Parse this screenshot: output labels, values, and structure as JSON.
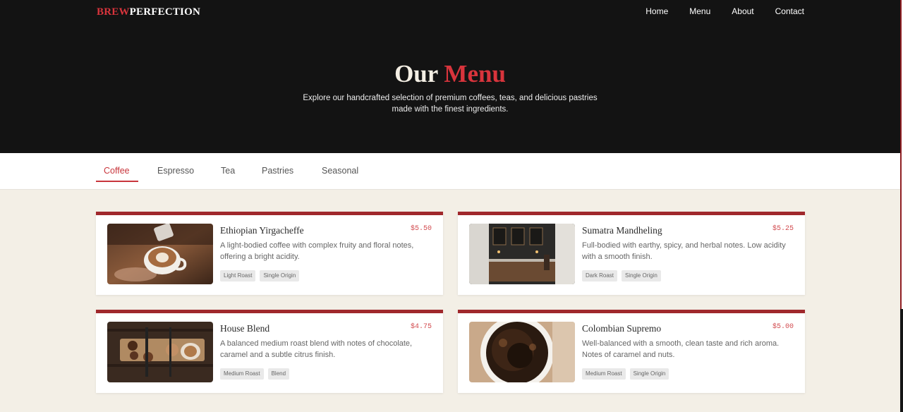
{
  "brand": {
    "part1": "BREW",
    "part2": "PERFECTION"
  },
  "nav": [
    "Home",
    "Menu",
    "About",
    "Contact"
  ],
  "hero": {
    "title_part1": "Our",
    "title_part2": "Menu",
    "subtitle": "Explore our handcrafted selection of premium coffees, teas, and delicious pastries made with the finest ingredients."
  },
  "tabs": [
    "Coffee",
    "Espresso",
    "Tea",
    "Pastries",
    "Seasonal"
  ],
  "active_tab": "Coffee",
  "items": [
    {
      "name": "Ethiopian Yirgacheffe",
      "price": "$5.50",
      "desc": "A light-bodied coffee with complex fruity and floral notes, offering a bright acidity.",
      "tags": [
        "Light Roast",
        "Single Origin"
      ],
      "image": "latte-art-cup"
    },
    {
      "name": "Sumatra Mandheling",
      "price": "$5.25",
      "desc": "Full-bodied with earthy, spicy, and herbal notes. Low acidity with a smooth finish.",
      "tags": [
        "Dark Roast",
        "Single Origin"
      ],
      "image": "cafe-interior"
    },
    {
      "name": "House Blend",
      "price": "$4.75",
      "desc": "A balanced medium roast blend with notes of chocolate, caramel and a subtle citrus finish.",
      "tags": [
        "Medium Roast",
        "Blend"
      ],
      "image": "coffee-board"
    },
    {
      "name": "Colombian Supremo",
      "price": "$5.00",
      "desc": "Well-balanced with a smooth, clean taste and rich aroma. Notes of caramel and nuts.",
      "tags": [
        "Medium Roast",
        "Single Origin"
      ],
      "image": "black-coffee-cup"
    }
  ],
  "colors": {
    "accent": "#d8343c",
    "card_border": "#a0282c",
    "hero_bg": "#131313",
    "page_bg": "#f3efe6"
  }
}
